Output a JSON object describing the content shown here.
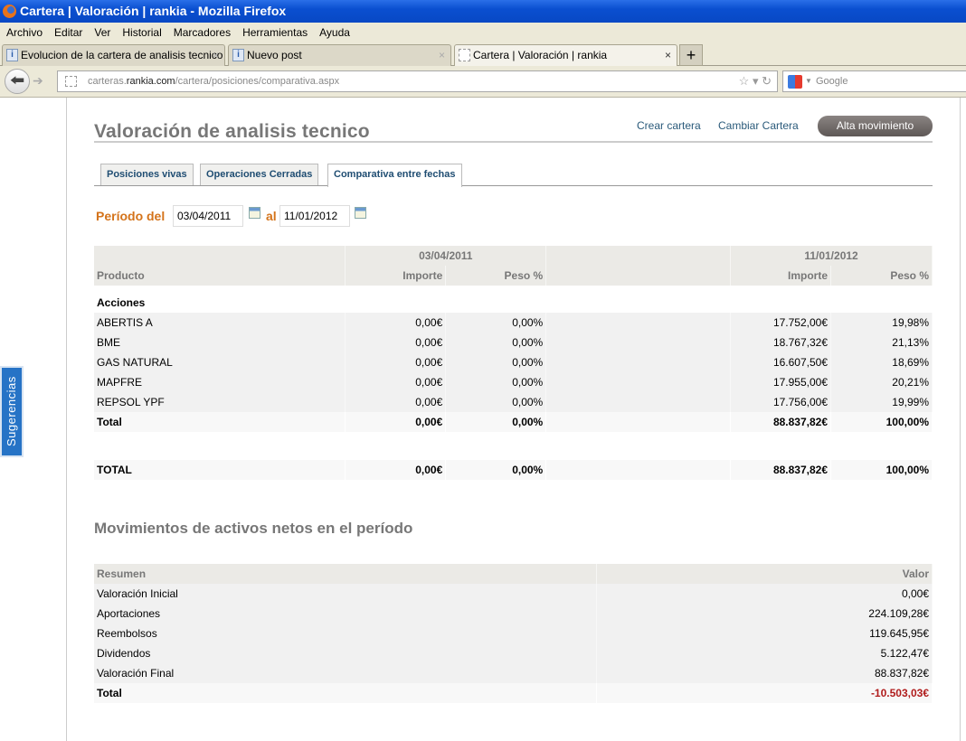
{
  "window": {
    "title": "Cartera | Valoración | rankia - Mozilla Firefox"
  },
  "menu": [
    "Archivo",
    "Editar",
    "Ver",
    "Historial",
    "Marcadores",
    "Herramientas",
    "Ayuda"
  ],
  "tabs": [
    {
      "label": "Evolucion de la cartera de analisis tecnico"
    },
    {
      "label": "Nuevo post"
    },
    {
      "label": "Cartera | Valoración | rankia"
    }
  ],
  "tab_close": "×",
  "new_tab": "+",
  "nav": {
    "url_domain_pre": "carteras.",
    "url_domain": "rankia.com",
    "url_path": "/cartera/posiciones/comparativa.aspx",
    "search_placeholder": "Google"
  },
  "sidebar_tab": "Sugerencias",
  "page": {
    "title": "Valoración de analisis tecnico",
    "links": [
      "Crear cartera",
      "Cambiar Cartera"
    ],
    "alta_button": "Alta movimiento",
    "tabs": [
      "Posiciones vivas",
      "Operaciones Cerradas",
      "Comparativa entre fechas"
    ],
    "periodo_label": "Período del",
    "al_label": "al",
    "date_from": "03/04/2011",
    "date_to": "11/01/2012"
  },
  "comparativa": {
    "date1": "03/04/2011",
    "date2": "11/01/2012",
    "col_producto": "Producto",
    "col_importe": "Importe",
    "col_peso": "Peso %",
    "group": "Acciones",
    "rows": [
      {
        "name": "ABERTIS A",
        "imp1": "0,00€",
        "peso1": "0,00%",
        "imp2": "17.752,00€",
        "peso2": "19,98%"
      },
      {
        "name": "BME",
        "imp1": "0,00€",
        "peso1": "0,00%",
        "imp2": "18.767,32€",
        "peso2": "21,13%"
      },
      {
        "name": "GAS NATURAL",
        "imp1": "0,00€",
        "peso1": "0,00%",
        "imp2": "16.607,50€",
        "peso2": "18,69%"
      },
      {
        "name": "MAPFRE",
        "imp1": "0,00€",
        "peso1": "0,00%",
        "imp2": "17.955,00€",
        "peso2": "20,21%"
      },
      {
        "name": "REPSOL YPF",
        "imp1": "0,00€",
        "peso1": "0,00%",
        "imp2": "17.756,00€",
        "peso2": "19,99%"
      }
    ],
    "total": {
      "name": "Total",
      "imp1": "0,00€",
      "peso1": "0,00%",
      "imp2": "88.837,82€",
      "peso2": "100,00%"
    },
    "grand_total": {
      "name": "TOTAL",
      "imp1": "0,00€",
      "peso1": "0,00%",
      "imp2": "88.837,82€",
      "peso2": "100,00%"
    }
  },
  "movimientos": {
    "title": "Movimientos de activos netos en el período",
    "col_resumen": "Resumen",
    "col_valor": "Valor",
    "rows": [
      {
        "label": "Valoración Inicial",
        "value": "0,00€"
      },
      {
        "label": "Aportaciones",
        "value": "224.109,28€"
      },
      {
        "label": "Reembolsos",
        "value": "119.645,95€"
      },
      {
        "label": "Dividendos",
        "value": "5.122,47€"
      },
      {
        "label": "Valoración Final",
        "value": "88.837,82€"
      }
    ],
    "total": {
      "label": "Total",
      "value": "-10.503,03€"
    },
    "negative_color": "#b01c1c"
  }
}
